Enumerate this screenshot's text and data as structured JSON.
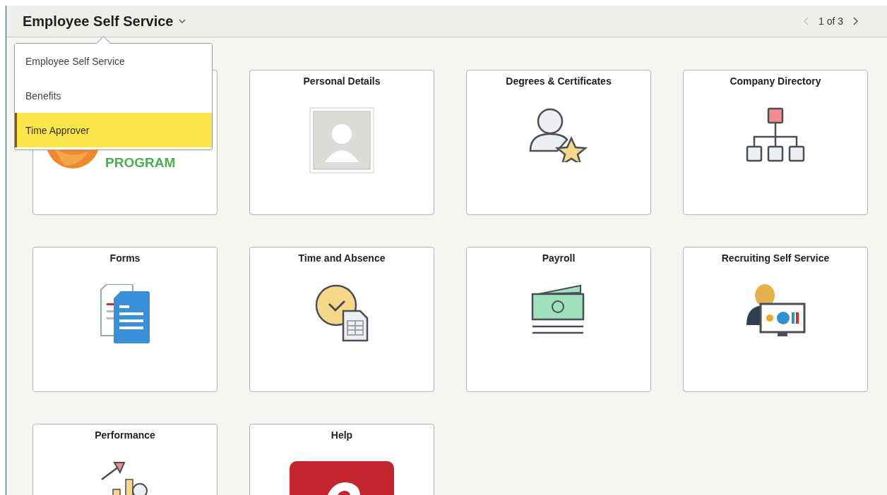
{
  "header": {
    "title": "Employee Self Service",
    "pager": {
      "text": "1 of 3",
      "prev_disabled": true,
      "next_disabled": false
    }
  },
  "homepage_menu": {
    "open": true,
    "items": [
      {
        "label": "Employee Self Service",
        "selected": false
      },
      {
        "label": "Benefits",
        "selected": false
      },
      {
        "label": "Time Approver",
        "selected": true
      }
    ]
  },
  "tiles": [
    {
      "kind": "logo",
      "lines": [
        "PROGRAM"
      ]
    },
    {
      "kind": "icon",
      "title": "Personal Details"
    },
    {
      "kind": "icon",
      "title": "Degrees & Certificates"
    },
    {
      "kind": "icon",
      "title": "Company Directory"
    },
    {
      "kind": "icon",
      "title": "Forms"
    },
    {
      "kind": "icon",
      "title": "Time and Absence"
    },
    {
      "kind": "icon",
      "title": "Payroll"
    },
    {
      "kind": "icon",
      "title": "Recruiting Self Service"
    },
    {
      "kind": "icon",
      "title": "Performance"
    },
    {
      "kind": "icon",
      "title": "Help"
    }
  ]
}
